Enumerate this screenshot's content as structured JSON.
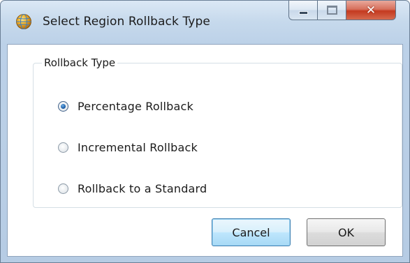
{
  "window": {
    "title": "Select Region Rollback Type",
    "icon": "globe-icon",
    "caption_buttons": {
      "minimize": "minimize-icon",
      "maximize": "maximize-icon",
      "close": "close-icon"
    }
  },
  "group": {
    "label": "Rollback Type",
    "options": [
      {
        "label": "Percentage Rollback",
        "selected": true
      },
      {
        "label": "Incremental Rollback",
        "selected": false
      },
      {
        "label": "Rollback to a Standard",
        "selected": false
      }
    ]
  },
  "buttons": {
    "cancel_label": "Cancel",
    "ok_label": "OK"
  },
  "colors": {
    "accent": "#3c7fb1",
    "close_button": "#c43a1f"
  }
}
